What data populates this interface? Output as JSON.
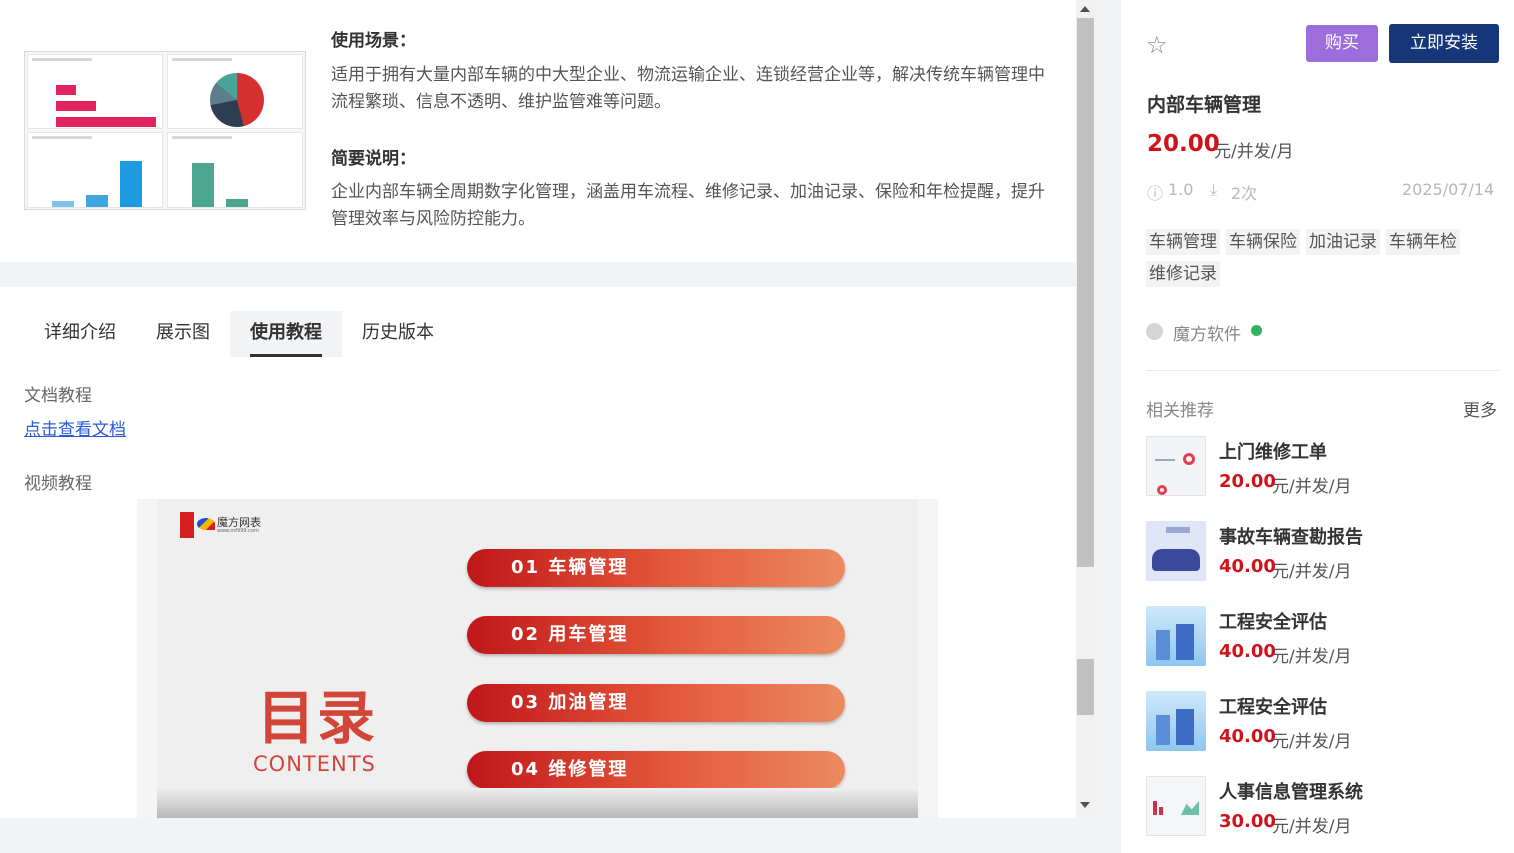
{
  "overview": {
    "scenario_heading": "使用场景：",
    "scenario_text": "适用于拥有大量内部车辆的中大型企业、物流运输企业、连锁经营企业等，解决传统车辆管理中流程繁琐、信息不透明、维护监管难等问题。",
    "summary_heading": "简要说明：",
    "summary_text": "企业内部车辆全周期数字化管理，涵盖用车流程、维修记录、加油记录、保险和年检提醒，提升管理效率与风险防控能力。"
  },
  "tabs": [
    {
      "label": "详细介绍",
      "active": false
    },
    {
      "label": "展示图",
      "active": false
    },
    {
      "label": "使用教程",
      "active": true
    },
    {
      "label": "历史版本",
      "active": false
    }
  ],
  "tutorial": {
    "doc_label": "文档教程",
    "doc_link": "点击查看文档",
    "video_label": "视频教程"
  },
  "video": {
    "logo_text": "魔方网表",
    "logo_sub": "www.mf999.com",
    "title": "目录",
    "subtitle": "CONTENTS",
    "items": [
      "01  车辆管理",
      "02  用车管理",
      "03  加油管理",
      "04  维修管理"
    ]
  },
  "product": {
    "buy_label": "购买",
    "install_label": "立即安装",
    "name": "内部车辆管理",
    "price": "20.00",
    "price_unit": "元/并发/月",
    "version": "1.0",
    "downloads": "2次",
    "date": "2025/07/14",
    "tags": [
      "车辆管理",
      "车辆保险",
      "加油记录",
      "车辆年检",
      "维修记录"
    ],
    "author": "魔方软件"
  },
  "related": {
    "title": "相关推荐",
    "more": "更多",
    "items": [
      {
        "name": "上门维修工单",
        "price": "20.00",
        "unit": "元/并发/月"
      },
      {
        "name": "事故车辆查勘报告",
        "price": "40.00",
        "unit": "元/并发/月"
      },
      {
        "name": "工程安全评估",
        "price": "40.00",
        "unit": "元/并发/月"
      },
      {
        "name": "工程安全评估",
        "price": "40.00",
        "unit": "元/并发/月"
      },
      {
        "name": "人事信息管理系统",
        "price": "30.00",
        "unit": "元/并发/月"
      }
    ]
  },
  "colors": {
    "brand_dark": "#16367a",
    "buy_purple": "#9d6ddc",
    "price_red": "#d0121b",
    "link_blue": "#2b5cd6"
  }
}
